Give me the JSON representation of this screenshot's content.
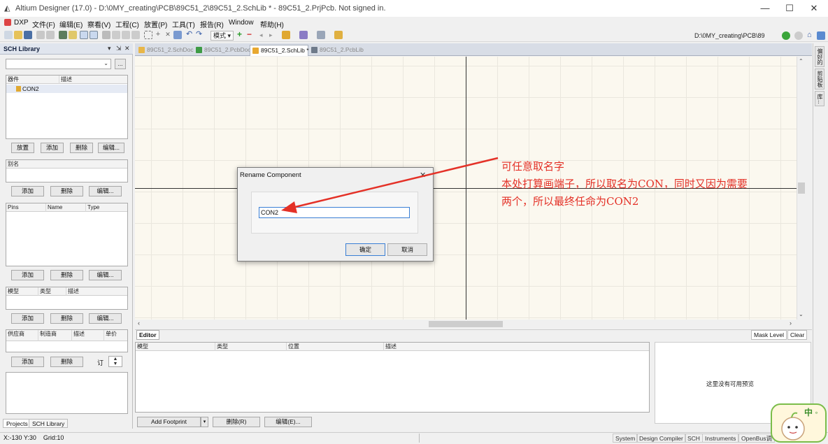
{
  "window": {
    "title": "Altium Designer (17.0) - D:\\0MY_creating\\PCB\\89C51_2\\89C51_2.SchLib * - 89C51_2.PrjPcb. Not signed in.",
    "controls": [
      "—",
      "☐",
      "✕"
    ]
  },
  "menu": {
    "items": [
      "DXP",
      "文件(F)",
      "编辑(E)",
      "察看(V)",
      "工程(C)",
      "放置(P)",
      "工具(T)",
      "报告(R)",
      "Window",
      "帮助(H)"
    ]
  },
  "toolbar": {
    "mode_button": "模式 ▾",
    "path": "D:\\0MY_creating\\PCB\\89"
  },
  "left_panel": {
    "title": "SCH Library",
    "controls": [
      "▾",
      "⇲",
      "✕"
    ],
    "filter_dropdown": "",
    "filter_btn": "...",
    "components": {
      "headers": [
        "器件",
        "描述"
      ],
      "items": [
        "CON2"
      ],
      "buttons": [
        "放置",
        "添加",
        "删除",
        "编辑..."
      ]
    },
    "aliases": {
      "header": "别名",
      "buttons": [
        "添加",
        "删除",
        "编辑..."
      ]
    },
    "pins": {
      "headers": [
        "Pins",
        "Name",
        "Type"
      ],
      "buttons": [
        "添加",
        "删除",
        "编辑..."
      ]
    },
    "models": {
      "headers": [
        "模型",
        "类型",
        "描述"
      ],
      "buttons": [
        "添加",
        "删除",
        "编辑..."
      ]
    },
    "suppliers": {
      "headers": [
        "供应商",
        "制造商",
        "描述",
        "单价"
      ],
      "buttons": [
        "添加",
        "删除"
      ],
      "order_label": "订",
      "order_value": "1"
    }
  },
  "doc_tabs": [
    {
      "label": "89C51_2.SchDoc",
      "active": false,
      "color": "#e8b648"
    },
    {
      "label": "89C51_2.PcbDoc",
      "active": false,
      "color": "#3e9b45"
    },
    {
      "label": "89C51_2.SchLib *",
      "active": true,
      "color": "#e8a830"
    },
    {
      "label": "89C51_2.PcbLib",
      "active": false,
      "color": "#6e7a8a"
    }
  ],
  "right_sidebar": {
    "tabs": [
      "偏好的",
      "剪贴板",
      "库..."
    ]
  },
  "dialog": {
    "title": "Rename Component",
    "close": "✕",
    "input_value": "CON2",
    "ok": "确定",
    "cancel": "取消"
  },
  "annotation": {
    "lines": [
      "可任意取名字",
      "本处打算画端子，所以取名为CON，同时又因为需要",
      "两个，所以最终任命为CON2"
    ]
  },
  "editor": {
    "tab": "Editor",
    "mask_level": "Mask Level",
    "clear": "Clear",
    "headers": [
      "模型",
      "类型",
      "位置",
      "描述"
    ],
    "buttons": [
      "Add Footprint",
      "删除(R)",
      "编辑(E)..."
    ],
    "preview_text": "这里没有可用预览"
  },
  "bottom_tabs": [
    "Projects",
    "SCH Library"
  ],
  "status": {
    "coords": "X:-130 Y:30",
    "grid": "Grid:10",
    "right": [
      "System",
      "Design Compiler",
      "SCH",
      "Instruments",
      "OpenBus调"
    ]
  },
  "watermark": {
    "text": "中 ◦"
  },
  "colors": {
    "annotation": "#e43127",
    "canvas_bg": "#fbf8ef",
    "focus_border": "#3a7fd5"
  }
}
